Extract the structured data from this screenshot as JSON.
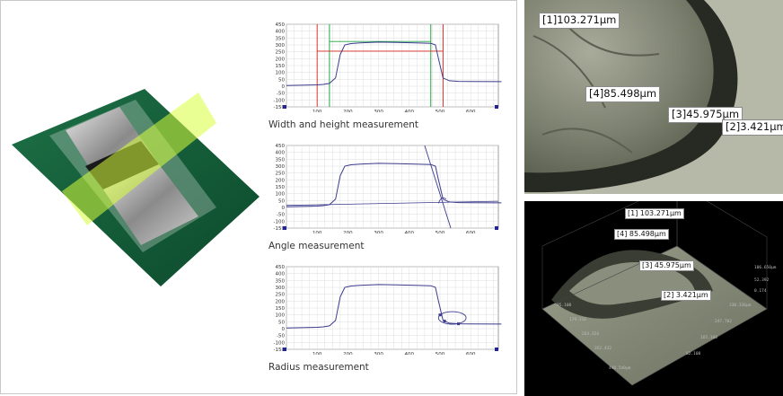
{
  "plots": [
    {
      "caption": "Width and height measurement",
      "chart_data": {
        "type": "line",
        "x": [
          0,
          100,
          120,
          140,
          160,
          175,
          190,
          210,
          240,
          300,
          360,
          420,
          470,
          485,
          495,
          510,
          530,
          560,
          600,
          700
        ],
        "y": [
          5,
          10,
          13,
          20,
          60,
          230,
          300,
          310,
          315,
          320,
          318,
          315,
          312,
          300,
          200,
          60,
          40,
          35,
          34,
          33
        ],
        "ylim": [
          -150,
          450
        ],
        "xlim": [
          0,
          690
        ],
        "yticks": [
          -150,
          -100,
          -50,
          0,
          50,
          100,
          150,
          200,
          250,
          300,
          350,
          400,
          450
        ],
        "xticks": [
          100,
          200,
          300,
          400,
          500,
          600
        ]
      }
    },
    {
      "caption": "Angle measurement",
      "chart_data": {
        "type": "line",
        "x": [
          0,
          100,
          120,
          140,
          160,
          175,
          190,
          210,
          240,
          300,
          360,
          420,
          470,
          485,
          495,
          510,
          530,
          560,
          600,
          700
        ],
        "y": [
          5,
          10,
          13,
          20,
          60,
          230,
          300,
          310,
          315,
          320,
          318,
          315,
          312,
          300,
          200,
          60,
          40,
          35,
          34,
          33
        ],
        "ylim": [
          -150,
          450
        ],
        "xlim": [
          0,
          690
        ],
        "yticks": [
          -150,
          -100,
          -50,
          0,
          50,
          100,
          150,
          200,
          250,
          300,
          350,
          400,
          450
        ],
        "xticks": [
          100,
          200,
          300,
          400,
          500,
          600
        ]
      }
    },
    {
      "caption": "Radius measurement",
      "chart_data": {
        "type": "line",
        "x": [
          0,
          100,
          120,
          140,
          160,
          175,
          190,
          210,
          240,
          300,
          360,
          420,
          470,
          485,
          495,
          510,
          530,
          560,
          600,
          700
        ],
        "y": [
          5,
          10,
          13,
          20,
          60,
          230,
          300,
          310,
          315,
          320,
          318,
          315,
          312,
          300,
          200,
          60,
          40,
          35,
          34,
          33
        ],
        "ylim": [
          -150,
          450
        ],
        "xlim": [
          0,
          690
        ],
        "yticks": [
          -150,
          -100,
          -50,
          0,
          50,
          100,
          150,
          200,
          250,
          300,
          350,
          400,
          450
        ],
        "xticks": [
          100,
          200,
          300,
          400,
          500,
          600
        ]
      }
    }
  ],
  "top_photo": {
    "labels": [
      "[1]103.271μm",
      "[4]85.498μm",
      "[3]45.975μm",
      "[2]3.421μm"
    ]
  },
  "bottom_photo": {
    "labels": [
      "[1] 103.271μm",
      "[4] 85.498μm",
      "[3] 45.975μm",
      "[2] 3.421μm"
    ],
    "axis_values": [
      "95.108",
      "179.216",
      "264.324",
      "352.432",
      "440.540μm",
      "82.108",
      "165.108",
      "247.702",
      "330.336μm",
      "0.174",
      "52.392",
      "106.650μm"
    ]
  },
  "colors": {
    "curve": "#3a3a8c",
    "red": "#e0302a",
    "green": "#20a848",
    "pcb": "#145c3a"
  }
}
